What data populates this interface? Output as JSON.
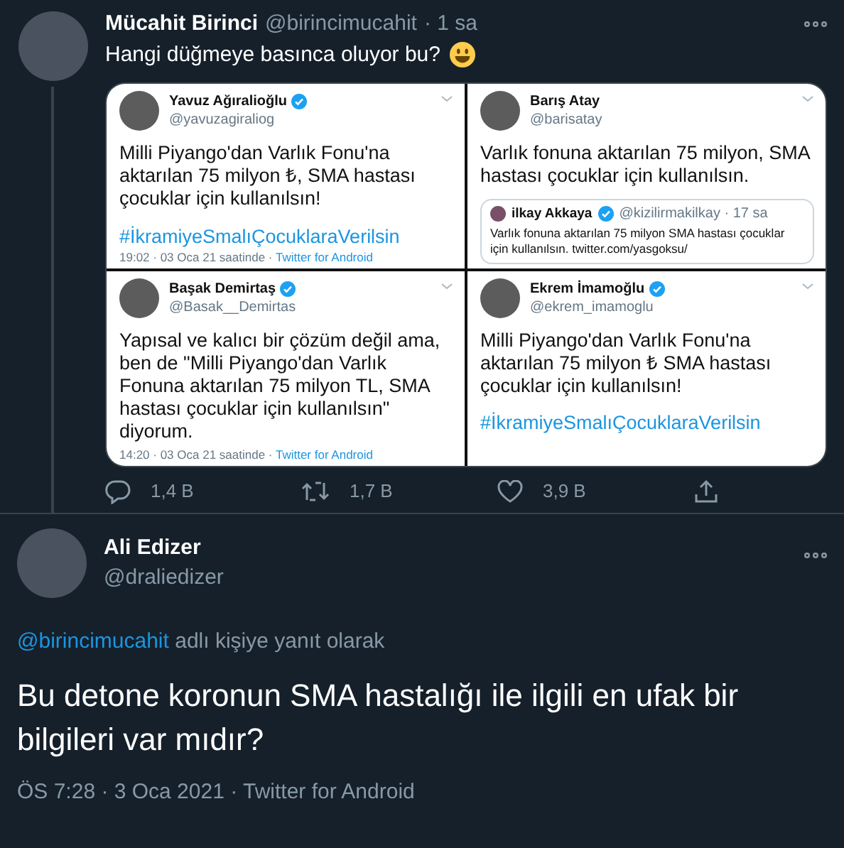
{
  "tweet": {
    "name": "Mücahit Birinci",
    "handle": "@birincimucahit",
    "time": "· 1 sa",
    "text": "Hangi düğmeye basınca oluyor bu?",
    "collage": [
      {
        "name": "Yavuz Ağıralioğlu",
        "handle": "@yavuzagiraliog",
        "verified": true,
        "text": "Milli Piyango'dan Varlık Fonu'na aktarılan 75 milyon ₺, SMA hastası çocuklar için kullanılsın!",
        "hashtag": "#İkramiyeSmalıÇocuklaraVerilsin",
        "footer_time": "19:02 · 03 Oca 21 saatinde ·",
        "footer_source": "Twitter for Android"
      },
      {
        "name": "Barış Atay",
        "handle": "@barisatay",
        "verified": false,
        "text": "Varlık fonuna aktarılan 75 milyon, SMA hastası çocuklar için kullanılsın.",
        "quote": {
          "name": "ilkay Akkaya",
          "handle": "@kizilirmakilkay · 17 sa",
          "text": "Varlık fonuna aktarılan 75 milyon SMA hastası çocuklar için kullanılsın. twitter.com/yasgoksu/"
        }
      },
      {
        "name": "Başak Demirtaş",
        "handle": "@Basak__Demirtas",
        "verified": true,
        "text": "Yapısal ve kalıcı bir çözüm değil ama, ben de \"Milli Piyango'dan Varlık Fonuna aktarılan 75 milyon TL, SMA hastası çocuklar için kullanılsın\" diyorum.",
        "footer_time": "14:20 · 03 Oca 21 saatinde ·",
        "footer_source": "Twitter for Android"
      },
      {
        "name": "Ekrem İmamoğlu",
        "handle": "@ekrem_imamoglu",
        "verified": true,
        "text": "Milli Piyango'dan Varlık Fonu'na aktarılan 75 milyon ₺ SMA hastası çocuklar için kullanılsın!",
        "hashtag": "#İkramiyeSmalıÇocuklaraVerilsin"
      }
    ],
    "actions": [
      {
        "kind": "reply",
        "count": "1,4 B"
      },
      {
        "kind": "retweet",
        "count": "1,7 B"
      },
      {
        "kind": "like",
        "count": "3,9 B"
      },
      {
        "kind": "share"
      }
    ]
  },
  "reply": {
    "name": "Ali Edizer",
    "handle": "@draliedizer",
    "reply_to": "@birincimucahit",
    "reply_to_text": "adlı kişiye yanıt olarak",
    "text": "Bu detone koronun SMA hastalığı ile ilgili en ufak bir bilgileri var mıdır?",
    "meta": "ÖS 7:28 · 3 Oca 2021 · Twitter for Android"
  }
}
